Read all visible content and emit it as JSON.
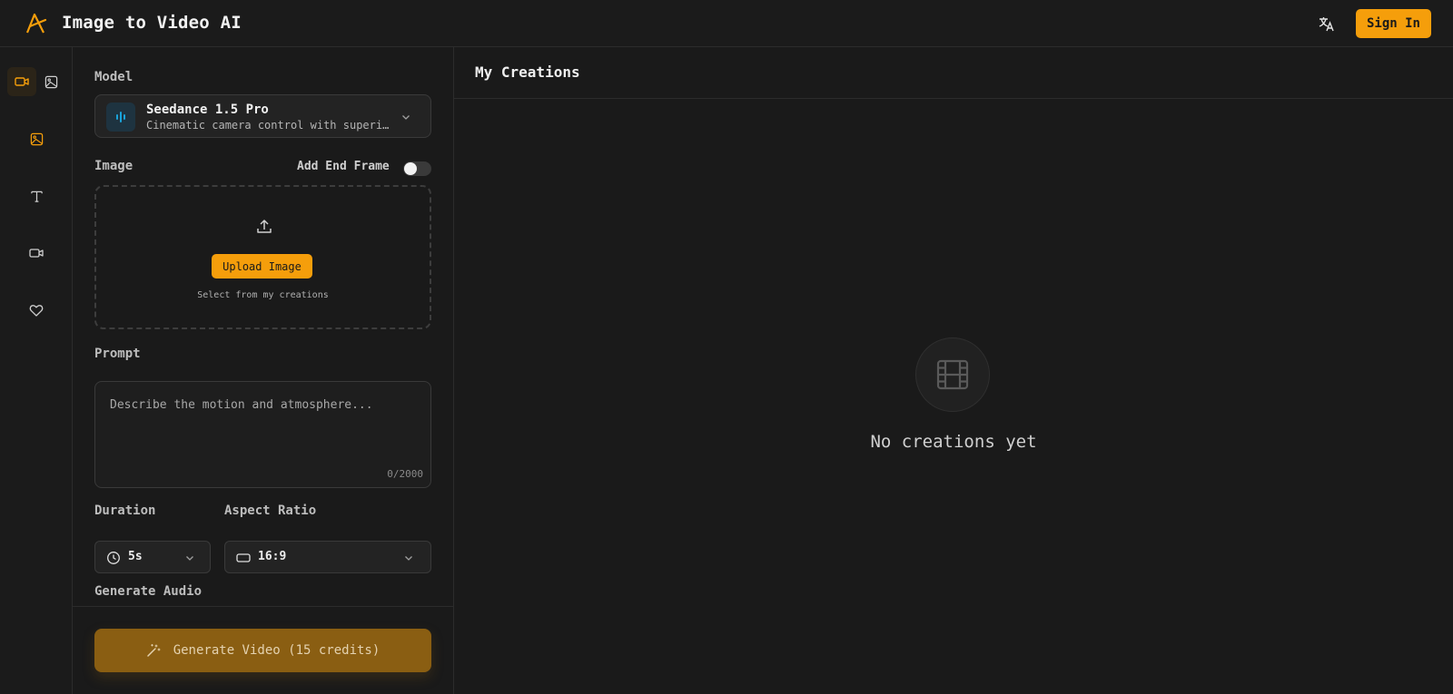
{
  "header": {
    "title": "Image to Video AI",
    "sign_in": "Sign In"
  },
  "rail": {
    "items": [
      "video-mode",
      "image-mode",
      "image-to-video",
      "text-to-video",
      "video-to-video",
      "favorites"
    ]
  },
  "form": {
    "model_label": "Model",
    "model_name": "Seedance 1.5 Pro",
    "model_desc": "Cinematic camera control with superi…",
    "image_label": "Image",
    "end_frame_label": "Add End Frame",
    "end_frame_enabled": false,
    "upload_button": "Upload Image",
    "select_creations": "Select from my creations",
    "prompt_label": "Prompt",
    "prompt_placeholder": "Describe the motion and atmosphere...",
    "prompt_value": "",
    "char_count": "0/2000",
    "duration_label": "Duration",
    "duration_value": "5s",
    "aspect_label": "Aspect Ratio",
    "aspect_value": "16:9",
    "generate_audio_label": "Generate Audio",
    "generate_button": "Generate Video (15 credits)"
  },
  "main": {
    "title": "My Creations",
    "empty_text": "No creations yet"
  },
  "colors": {
    "accent": "#f59e0b",
    "background": "#1a1a1a",
    "generate_disabled": "#8a5e12",
    "model_icon": "#1aa3d9"
  }
}
